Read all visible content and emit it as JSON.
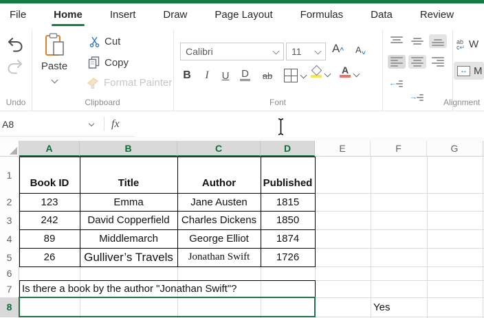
{
  "window": {
    "accent_color": "#107C41"
  },
  "tabs": [
    {
      "label": "File"
    },
    {
      "label": "Home",
      "active": true
    },
    {
      "label": "Insert"
    },
    {
      "label": "Draw"
    },
    {
      "label": "Page Layout"
    },
    {
      "label": "Formulas"
    },
    {
      "label": "Data"
    },
    {
      "label": "Review"
    }
  ],
  "ribbon": {
    "undo": {
      "label": "Undo"
    },
    "clipboard": {
      "label": "Clipboard",
      "paste": "Paste",
      "cut": "Cut",
      "copy": "Copy",
      "format_painter": "Format Painter"
    },
    "font": {
      "label": "Font",
      "font_name": "Calibri",
      "font_size": "11",
      "bold": "B",
      "italic": "I",
      "underline": "U",
      "double_underline": "D",
      "strikethrough": "ab"
    },
    "alignment": {
      "label": "Alignment",
      "wrap_text": "W",
      "merge_center": "M"
    }
  },
  "formula_bar": {
    "name_box": "A8",
    "fx": "fx",
    "value": ""
  },
  "sheet": {
    "columns": [
      "A",
      "B",
      "C",
      "D",
      "E",
      "F",
      "G"
    ],
    "selected_columns": [
      "A",
      "B",
      "C",
      "D"
    ],
    "rows": [
      "1",
      "2",
      "3",
      "4",
      "5",
      "6",
      "7",
      "8"
    ],
    "selected_row": "8",
    "active_cell": "A8",
    "table": {
      "headers": [
        "Book ID",
        "Title",
        "Author",
        "Published"
      ],
      "rows": [
        [
          "123",
          "Emma",
          "Jane Austen",
          "1815"
        ],
        [
          "242",
          "David Copperfield",
          "Charles Dickens",
          "1850"
        ],
        [
          "89",
          "Middlemarch",
          "George Elliot",
          "1874"
        ],
        [
          "26",
          "Gulliver’s Travels",
          "Jonathan Swift",
          "1726"
        ]
      ]
    },
    "question": "Is there a book by the author \"Jonathan Swift\"?",
    "answer": "Yes"
  }
}
